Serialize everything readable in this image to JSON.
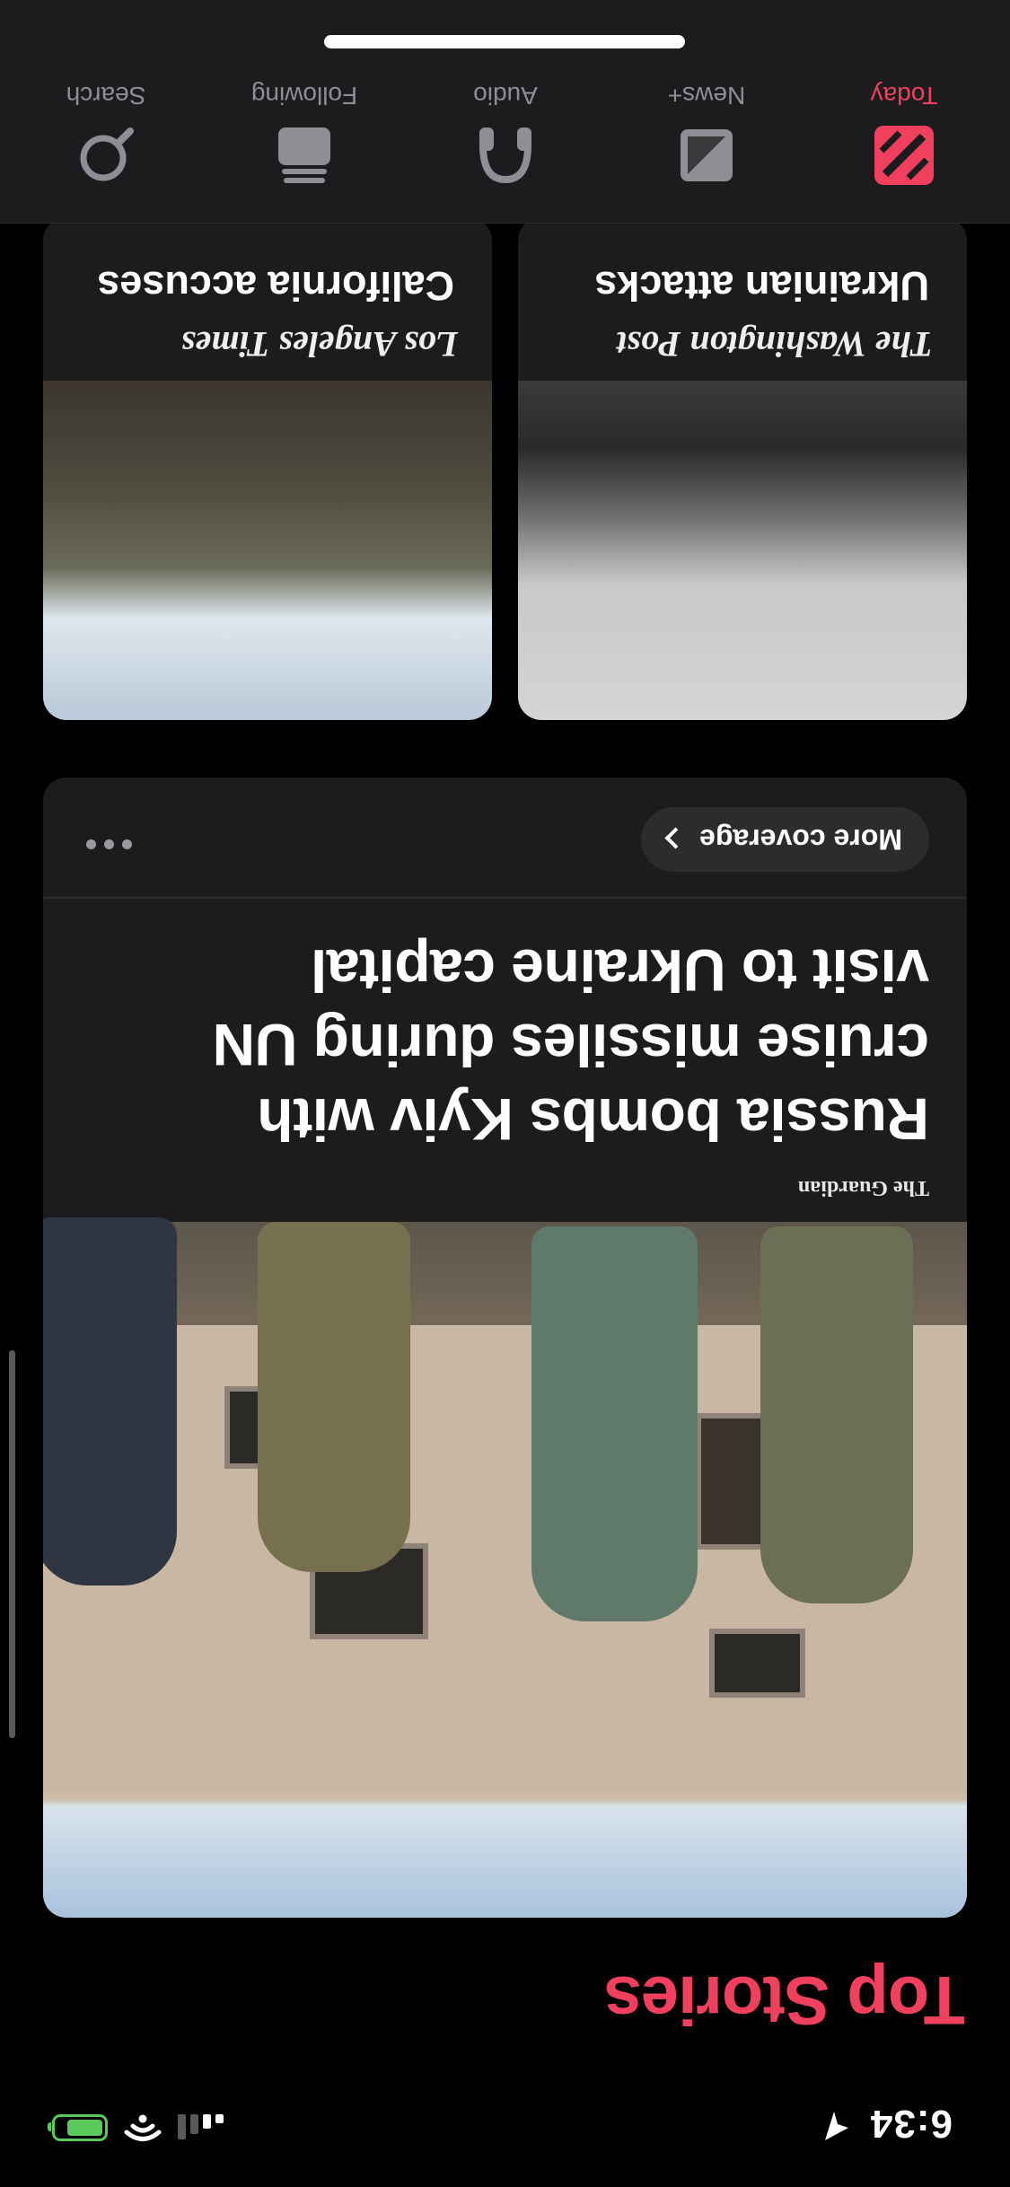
{
  "status_bar": {
    "time": "6:34"
  },
  "section": {
    "title": "Top Stories"
  },
  "hero_story": {
    "source": "The Guardian",
    "headline": "Russia bombs Kyiv with cruise missiles during UN visit to Ukraine capital",
    "more_coverage_label": "More coverage"
  },
  "small_stories": [
    {
      "source": "The Washington Post",
      "headline": "Ukrainian attacks"
    },
    {
      "source": "Los Angeles Times",
      "headline": "California accuses"
    }
  ],
  "tab_bar": {
    "tabs": [
      {
        "label": "Today",
        "icon": "news-today-icon",
        "active": true
      },
      {
        "label": "News+",
        "icon": "news-plus-icon",
        "active": false
      },
      {
        "label": "Audio",
        "icon": "headphones-icon",
        "active": false
      },
      {
        "label": "Following",
        "icon": "following-icon",
        "active": false
      },
      {
        "label": "Search",
        "icon": "search-icon",
        "active": false
      }
    ]
  },
  "colors": {
    "accent": "#f1405e",
    "card": "#1c1c1e",
    "battery": "#5ac85a"
  }
}
